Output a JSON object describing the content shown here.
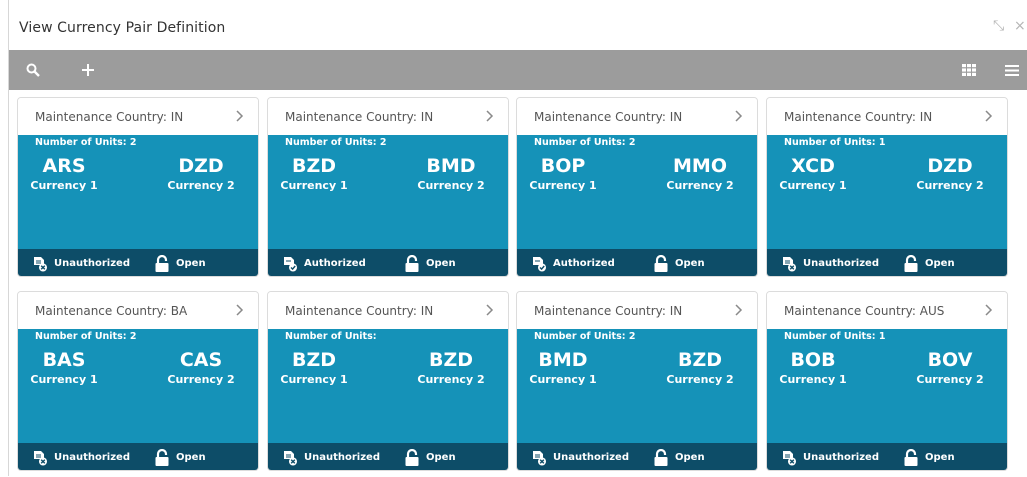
{
  "window": {
    "title": "View Currency Pair Definition",
    "minimize_glyph": "⤡",
    "close_glyph": "×"
  },
  "toolbar": {
    "icons": [
      "search-icon",
      "plus-icon",
      "grid-view-icon",
      "list-view-icon"
    ]
  },
  "colors": {
    "toolbar": "#9c9c9c",
    "card_body": "#1592b8",
    "card_footer": "#0d4d68"
  },
  "cards": [
    {
      "country_label": "Maintenance Country:",
      "country": "IN",
      "units_label": "Number of Units:",
      "units": "2",
      "currency1": "ARS",
      "currency1_caption": "Currency 1",
      "currency2": "DZD",
      "currency2_caption": "Currency 2",
      "auth_status": "Unauthorized",
      "auth_icon": "unauthorized-icon",
      "record_status": "Open"
    },
    {
      "country_label": "Maintenance Country:",
      "country": "IN",
      "units_label": "Number of Units:",
      "units": "2",
      "currency1": "BZD",
      "currency1_caption": "Currency 1",
      "currency2": "BMD",
      "currency2_caption": "Currency 2",
      "auth_status": "Authorized",
      "auth_icon": "authorized-icon",
      "record_status": "Open"
    },
    {
      "country_label": "Maintenance Country:",
      "country": "IN",
      "units_label": "Number of Units:",
      "units": "2",
      "currency1": "BOP",
      "currency1_caption": "Currency 1",
      "currency2": "MMO",
      "currency2_caption": "Currency 2",
      "auth_status": "Authorized",
      "auth_icon": "authorized-icon",
      "record_status": "Open"
    },
    {
      "country_label": "Maintenance Country:",
      "country": "IN",
      "units_label": "Number of Units:",
      "units": "1",
      "currency1": "XCD",
      "currency1_caption": "Currency 1",
      "currency2": "DZD",
      "currency2_caption": "Currency 2",
      "auth_status": "Unauthorized",
      "auth_icon": "unauthorized-icon",
      "record_status": "Open"
    },
    {
      "country_label": "Maintenance Country:",
      "country": "BA",
      "units_label": "Number of Units:",
      "units": "2",
      "currency1": "BAS",
      "currency1_caption": "Currency 1",
      "currency2": "CAS",
      "currency2_caption": "Currency 2",
      "auth_status": "Unauthorized",
      "auth_icon": "unauthorized-icon",
      "record_status": "Open"
    },
    {
      "country_label": "Maintenance Country:",
      "country": "IN",
      "units_label": "Number of Units:",
      "units": "",
      "currency1": "BZD",
      "currency1_caption": "Currency 1",
      "currency2": "BZD",
      "currency2_caption": "Currency 2",
      "auth_status": "Unauthorized",
      "auth_icon": "unauthorized-icon",
      "record_status": "Open"
    },
    {
      "country_label": "Maintenance Country:",
      "country": "IN",
      "units_label": "Number of Units:",
      "units": "2",
      "currency1": "BMD",
      "currency1_caption": "Currency 1",
      "currency2": "BZD",
      "currency2_caption": "Currency 2",
      "auth_status": "Unauthorized",
      "auth_icon": "unauthorized-icon",
      "record_status": "Open"
    },
    {
      "country_label": "Maintenance Country:",
      "country": "AUS",
      "units_label": "Number of Units:",
      "units": "1",
      "currency1": "BOB",
      "currency1_caption": "Currency 1",
      "currency2": "BOV",
      "currency2_caption": "Currency 2",
      "auth_status": "Unauthorized",
      "auth_icon": "unauthorized-icon",
      "record_status": "Open"
    }
  ]
}
